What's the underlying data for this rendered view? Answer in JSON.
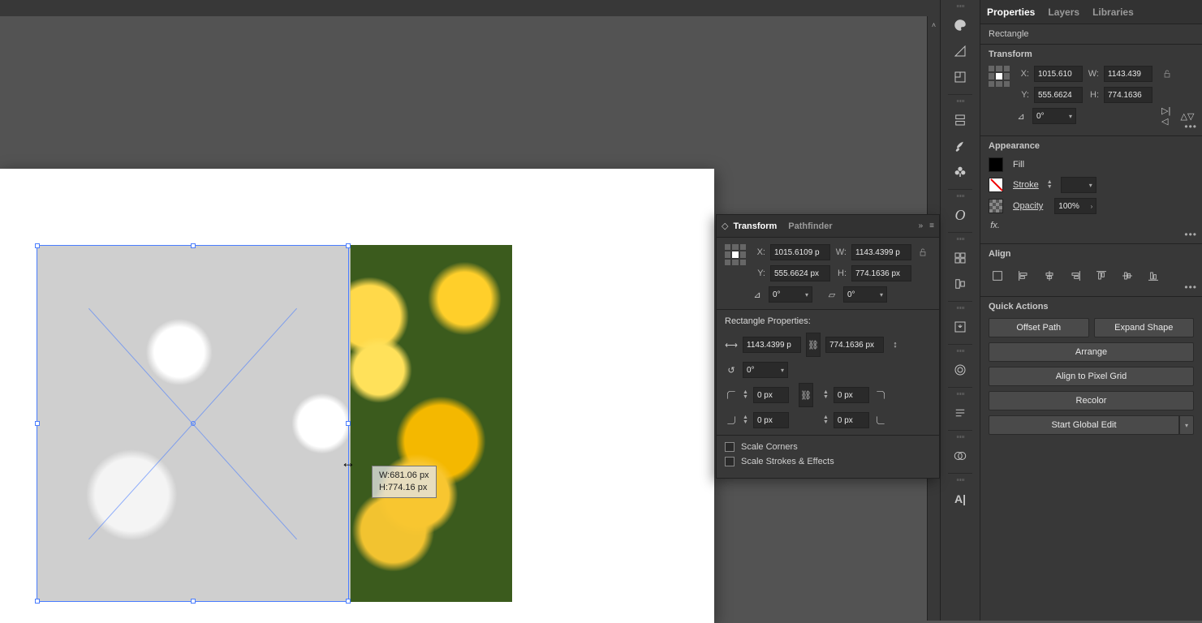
{
  "tabs": {
    "properties": "Properties",
    "layers": "Layers",
    "libraries": "Libraries"
  },
  "object_type": "Rectangle",
  "transform": {
    "title": "Transform",
    "x_label": "X:",
    "x": "1015.610",
    "y_label": "Y:",
    "y": "555.6624",
    "w_label": "W:",
    "w": "1143.439",
    "h_label": "H:",
    "h": "774.1636",
    "angle": "0°"
  },
  "appearance": {
    "title": "Appearance",
    "fill_label": "Fill",
    "stroke_label": "Stroke",
    "opacity_label": "Opacity",
    "opacity_value": "100%"
  },
  "align": {
    "title": "Align"
  },
  "quick_actions": {
    "title": "Quick Actions",
    "offset_path": "Offset Path",
    "expand_shape": "Expand Shape",
    "arrange": "Arrange",
    "align_pixel_grid": "Align to Pixel Grid",
    "recolor": "Recolor",
    "start_global_edit": "Start Global Edit"
  },
  "float_panel": {
    "tab_transform": "Transform",
    "tab_pathfinder": "Pathfinder",
    "x_label": "X:",
    "x": "1015.6109 p",
    "y_label": "Y:",
    "y": "555.6624 px",
    "w_label": "W:",
    "w": "1143.4399 p",
    "h_label": "H:",
    "h": "774.1636 px",
    "rotate": "0°",
    "shear": "0°",
    "rect_props_title": "Rectangle Properties:",
    "rect_w": "1143.4399 p",
    "rect_h": "774.1636 px",
    "rect_angle": "0°",
    "corner_tl": "0 px",
    "corner_tr": "0 px",
    "corner_bl": "0 px",
    "corner_br": "0 px",
    "scale_corners": "Scale Corners",
    "scale_strokes": "Scale Strokes & Effects"
  },
  "tooltip": {
    "w": "W:681.06 px",
    "h": "H:774.16 px"
  }
}
